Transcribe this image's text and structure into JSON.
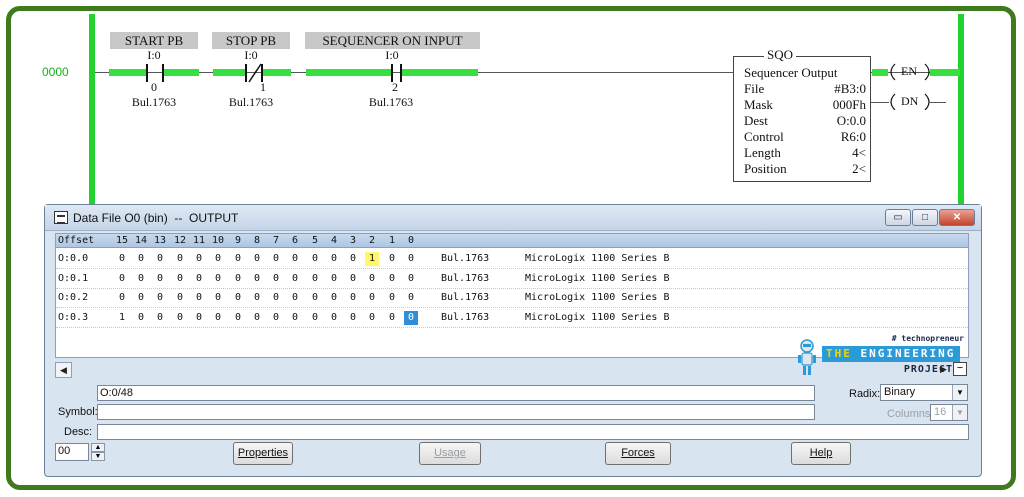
{
  "ladder": {
    "rung_number": "0000",
    "contacts": [
      {
        "title": "START PB",
        "address": "I:0",
        "bit": "0",
        "module": "Bul.1763",
        "type": "XIC"
      },
      {
        "title": "STOP PB",
        "address": "I:0",
        "bit": "1",
        "module": "Bul.1763",
        "type": "XIO"
      },
      {
        "title": "SEQUENCER ON INPUT",
        "address": "I:0",
        "bit": "2",
        "module": "Bul.1763",
        "type": "XIC"
      }
    ],
    "sqo": {
      "title": "SQO",
      "subtitle": "Sequencer Output",
      "params": [
        {
          "key": "File",
          "value": "#B3:0"
        },
        {
          "key": "Mask",
          "value": "000Fh"
        },
        {
          "key": "Dest",
          "value": "O:0.0"
        },
        {
          "key": "Control",
          "value": "R6:0"
        },
        {
          "key": "Length",
          "value": "4<"
        },
        {
          "key": "Position",
          "value": "2<"
        }
      ],
      "coil_en": "EN",
      "coil_dn": "DN"
    },
    "colors": {
      "rail": "#22d22e",
      "energized": "#36e043",
      "frame": "#3f7a1e"
    }
  },
  "window": {
    "title": "Data File O0 (bin)  --  OUTPUT",
    "buttons": {
      "minimize": "▭",
      "maximize": "□",
      "close": "✕"
    },
    "header": {
      "offset": "Offset",
      "bits": [
        "15",
        "14",
        "13",
        "12",
        "11",
        "10",
        "9",
        "8",
        "7",
        "6",
        "5",
        "4",
        "3",
        "2",
        "1",
        "0"
      ]
    },
    "rows": [
      {
        "offset": "O:0.0",
        "bits": [
          "0",
          "0",
          "0",
          "0",
          "0",
          "0",
          "0",
          "0",
          "0",
          "0",
          "0",
          "0",
          "0",
          "1",
          "0",
          "0"
        ],
        "module": "Bul.1763",
        "desc": "MicroLogix 1100 Series B"
      },
      {
        "offset": "O:0.1",
        "bits": [
          "0",
          "0",
          "0",
          "0",
          "0",
          "0",
          "0",
          "0",
          "0",
          "0",
          "0",
          "0",
          "0",
          "0",
          "0",
          "0"
        ],
        "module": "Bul.1763",
        "desc": "MicroLogix 1100 Series B"
      },
      {
        "offset": "O:0.2",
        "bits": [
          "0",
          "0",
          "0",
          "0",
          "0",
          "0",
          "0",
          "0",
          "0",
          "0",
          "0",
          "0",
          "0",
          "0",
          "0",
          "0"
        ],
        "module": "Bul.1763",
        "desc": "MicroLogix 1100 Series B"
      },
      {
        "offset": "O:0.3",
        "bits": [
          "1",
          "0",
          "0",
          "0",
          "0",
          "0",
          "0",
          "0",
          "0",
          "0",
          "0",
          "0",
          "0",
          "0",
          "0",
          "0"
        ],
        "module": "Bul.1763",
        "desc": "MicroLogix 1100 Series B"
      }
    ],
    "highlight": {
      "yellow": {
        "row": 0,
        "bit_index": 13
      },
      "blue": {
        "row": 3,
        "bit_index": 15
      }
    },
    "logo": {
      "tag": "# technopreneur",
      "the": "THE",
      "main": "ENGINEERING",
      "sub": "PROJECTS"
    },
    "address_field": "O:0/48",
    "symbol_label": "Symbol:",
    "symbol_value": "",
    "desc_label": "Desc:",
    "desc_value": "",
    "radix_label": "Radix:",
    "radix_value": "Binary",
    "columns_label": "Columns:",
    "columns_value": "16",
    "spin_value": "00",
    "buttons_bottom": {
      "properties": "Properties",
      "usage": "Usage",
      "forces": "Forces",
      "help": "Help"
    }
  }
}
